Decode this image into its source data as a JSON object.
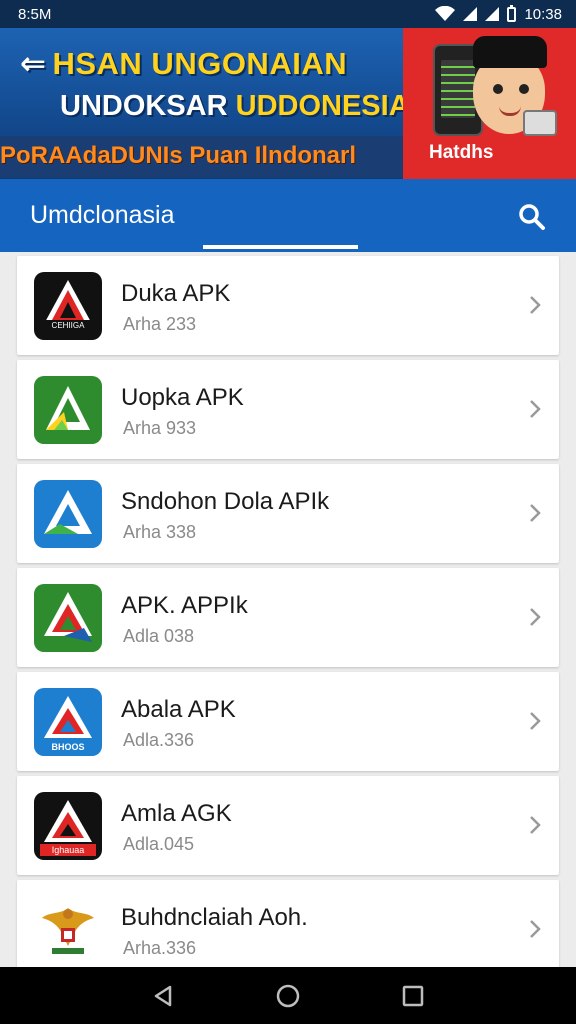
{
  "status": {
    "left_text": "8:5M",
    "time": "10:38",
    "icons": [
      "wifi-icon",
      "signal-icon",
      "signal-icon",
      "battery-icon"
    ]
  },
  "banner": {
    "line1": "HSAN UNGONAIAN",
    "line2_white": "UNDOKSAR ",
    "line2_yellow": "UDDONESIA",
    "line3": "PoRAAdaDUNIs Puan Ilndonarl",
    "promo_label": "Hatdhs",
    "colors": {
      "yellow": "#ffd21e",
      "orange": "#ff8a1e",
      "promo_red": "#e02a2a"
    }
  },
  "appbar": {
    "title": "Umdclonasia",
    "search_icon": "search-icon",
    "color": "#1565c0"
  },
  "apps": [
    {
      "name": "Duka APK",
      "subtitle": "Arha 233",
      "icon": "app-logo-black",
      "icon_bg": "#111111",
      "icon_tag": "CEHIIGA"
    },
    {
      "name": "Uopka APK",
      "subtitle": "Arha 933",
      "icon": "app-logo-green",
      "icon_bg": "#2e8b2e",
      "icon_tag": ""
    },
    {
      "name": "Sndohon Dola APIk",
      "subtitle": "Arha 338",
      "icon": "app-logo-blue",
      "icon_bg": "#1e7fd0",
      "icon_tag": ""
    },
    {
      "name": "APK. APPIk",
      "subtitle": "Adla 038",
      "icon": "app-logo-green",
      "icon_bg": "#2e8b2e",
      "icon_tag": ""
    },
    {
      "name": "Abala APK",
      "subtitle": "Adla.336",
      "icon": "app-logo-blue",
      "icon_bg": "#1e7fd0",
      "icon_tag": "BHOOS"
    },
    {
      "name": "Amla AGK",
      "subtitle": "Adla.045",
      "icon": "app-logo-black",
      "icon_bg": "#111111",
      "icon_tag": "Ighauaa"
    },
    {
      "name": "Buhdnclaiah Aoh.",
      "subtitle": "Arha.336",
      "icon": "garuda-emblem",
      "icon_bg": "#ffffff",
      "icon_tag": ""
    }
  ],
  "navbar": {
    "buttons": [
      "back-icon",
      "home-icon",
      "recents-icon"
    ]
  }
}
